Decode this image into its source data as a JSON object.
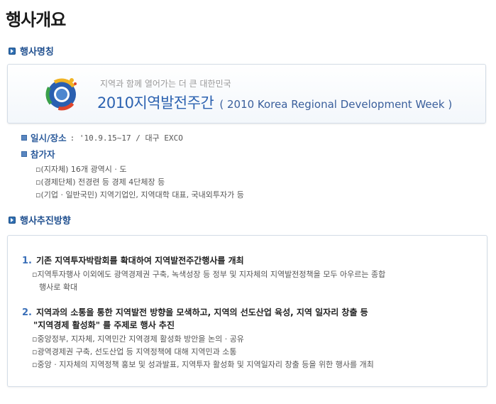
{
  "page_title": "행사개요",
  "sections": {
    "event_name": "행사명칭",
    "direction": "행사추진방향"
  },
  "banner": {
    "subtitle": "지역과 함께 열어가는 더 큰 대한민국",
    "year": "2010",
    "main_title": "지역발전주간",
    "english": "( 2010 Korea Regional Development Week )"
  },
  "info": {
    "datetime_label": "일시/장소",
    "datetime_value": ": '10.9.15~17 / 대구 EXCO",
    "participants_label": "참가자",
    "participants": [
      "(지자체) 16개 광역시 · 도",
      "(경제단체) 전경련 등 경제 4단체장 등",
      "(기업 · 일반국민) 지역기업인, 지역대학 대표, 국내외투자가 등"
    ]
  },
  "directions": [
    {
      "num": "1.",
      "title": "기존 지역투자박람회를 확대하여 지역발전주간행사를 개최",
      "title_line2": "",
      "items": [
        "지역투자행사 이외에도 광역경제권 구축, 녹색성장 등 정부 및 지자체의 지역발전정책을 모두 아우르는 종합",
        "행사로 확대"
      ]
    },
    {
      "num": "2.",
      "title": "지역과의 소통을 통한 지역발전 방향을 모색하고, 지역의 선도산업 육성, 지역 일자리 창출 등",
      "title_line2": "\"지역경제 활성화\" 를 주제로 행사 추진",
      "items": [
        "중앙정부, 지자체, 지역민간 지역경제 활성화 방안을 논의 · 공유",
        "광역경제권 구축, 선도산업 등 지역정책에 대해 지역민과 소통",
        "중앙 · 지자체의 지역정책 홍보 및 성과발표, 지역투자 활성화 및 지역일자리 창출 등을 위한 행사를 개최"
      ]
    }
  ]
}
